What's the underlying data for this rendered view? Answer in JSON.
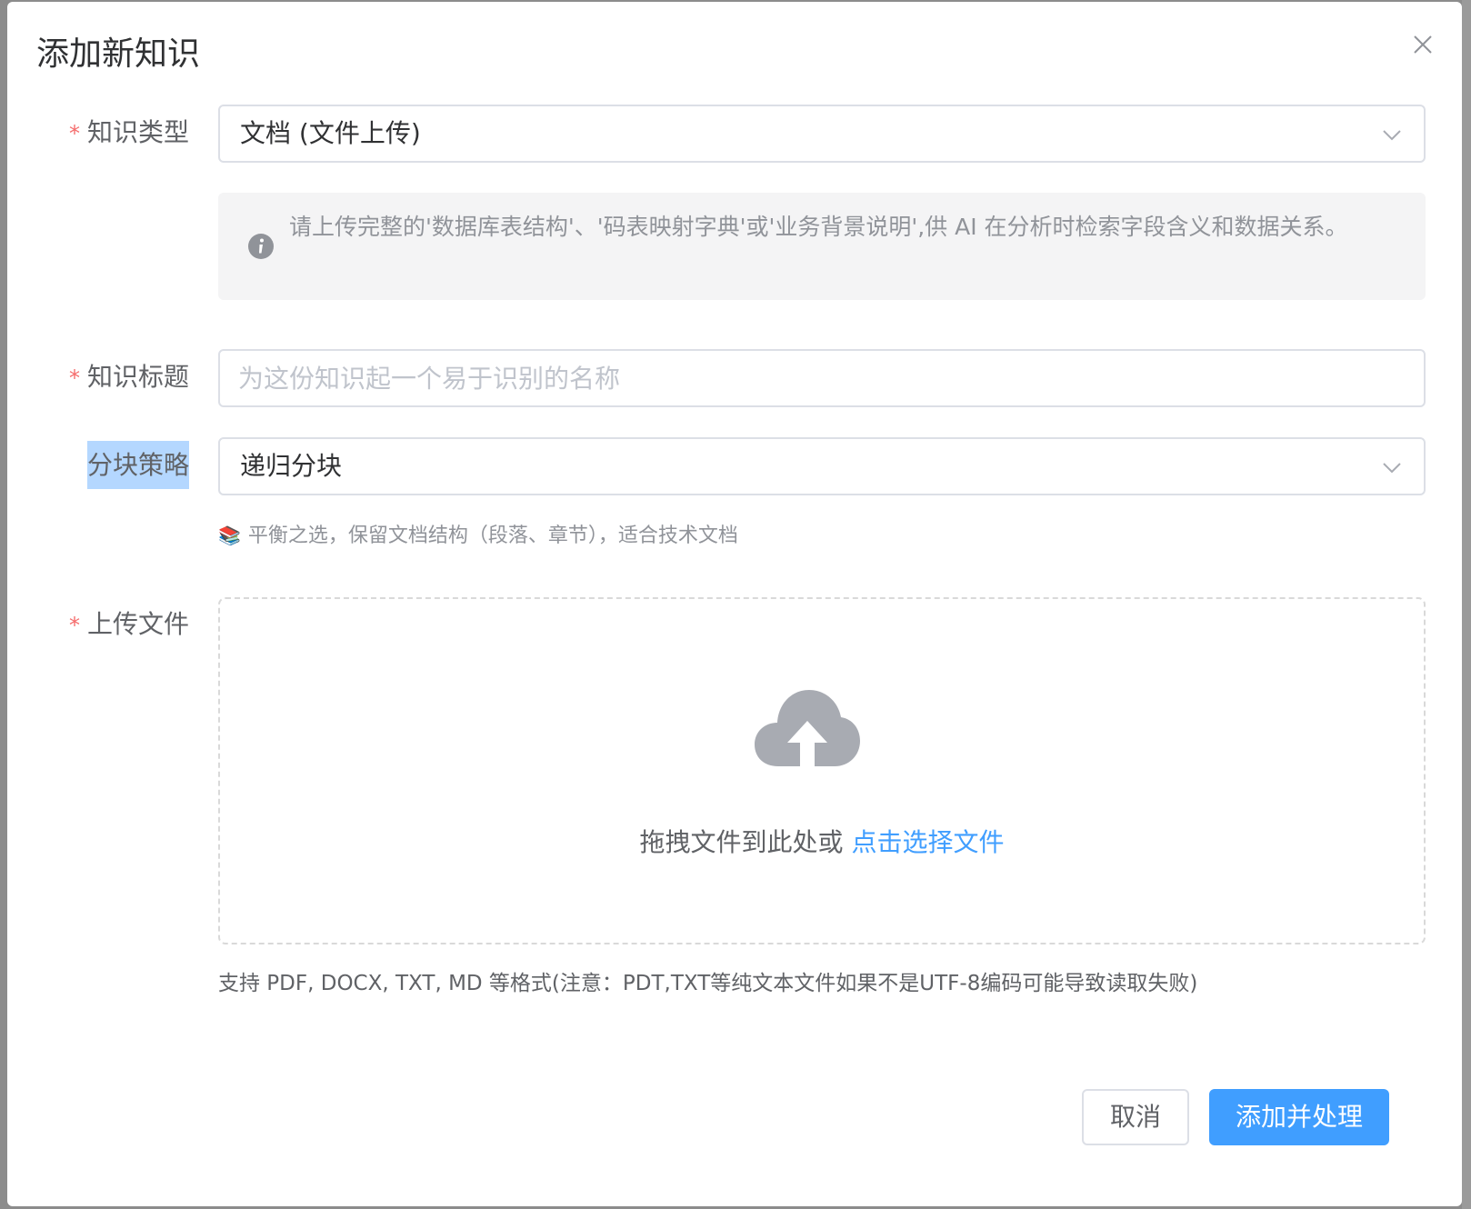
{
  "dialog": {
    "title": "添加新知识"
  },
  "form": {
    "knowledge_type": {
      "label": "知识类型",
      "required_mark": "*",
      "value": "文档 (文件上传)"
    },
    "info": {
      "text": "请上传完整的'数据库表结构'、'码表映射字典'或'业务背景说明',供 AI 在分析时检索字段含义和数据关系。"
    },
    "knowledge_title": {
      "label": "知识标题",
      "required_mark": "*",
      "value": "",
      "placeholder": "为这份知识起一个易于识别的名称"
    },
    "chunk_strategy": {
      "label": "分块策略",
      "value": "递归分块",
      "hint_emoji": "📚",
      "hint": "平衡之选，保留文档结构（段落、章节），适合技术文档"
    },
    "upload": {
      "label": "上传文件",
      "required_mark": "*",
      "drag_text": "拖拽文件到此处或 ",
      "click_text": "点击选择文件",
      "format_tip": "支持 PDF, DOCX, TXT, MD 等格式(注意：PDT,TXT等纯文本文件如果不是UTF-8编码可能导致读取失败)"
    }
  },
  "footer": {
    "cancel_label": "取消",
    "submit_label": "添加并处理"
  },
  "colors": {
    "primary": "#409eff",
    "required": "#f56c6c",
    "label_highlight": "#b4d7ff"
  },
  "icons": {
    "close": "close-icon",
    "chevron": "chevron-down-icon",
    "info": "info-icon",
    "upload": "upload-cloud-icon"
  }
}
